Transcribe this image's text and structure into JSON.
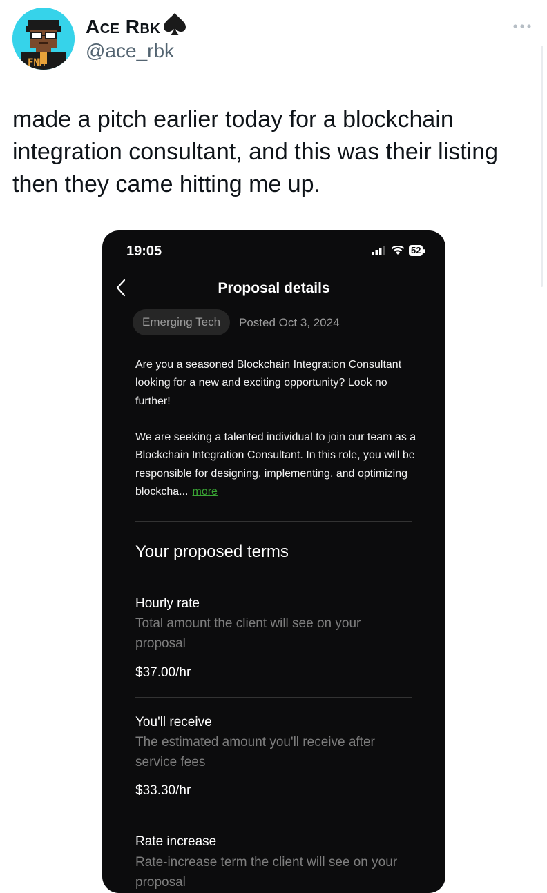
{
  "tweet": {
    "display_name": "Ace Rbk",
    "handle": "@ace_rbk",
    "text": "made a pitch earlier today for a blockchain\nintegration consultant, and this was their listing\nthen they came hitting me up.",
    "avatar_text": "FNM",
    "avatar_bg": "#36d3ea"
  },
  "phone": {
    "status": {
      "time": "19:05",
      "battery": "52"
    },
    "header": {
      "title": "Proposal details"
    },
    "tag": "Emerging Tech",
    "posted": "Posted Oct 3, 2024",
    "description": {
      "paragraph1": "Are you a seasoned Blockchain Integration Consultant looking for a new and exciting opportunity? Look no further!",
      "paragraph2": "We are seeking a talented individual to join our team as a Blockchain Integration Consultant. In this role, you will be responsible for designing, implementing, and optimizing blockcha...",
      "more_label": "more"
    },
    "terms": {
      "title": "Your proposed terms",
      "items": [
        {
          "label": "Hourly rate",
          "help": "Total amount the client will see on your proposal",
          "value": "$37.00/hr"
        },
        {
          "label": "You'll receive",
          "help": "The estimated amount you'll receive after service fees",
          "value": "$33.30/hr"
        },
        {
          "label": "Rate increase",
          "help": "Rate-increase term the client will see on your proposal"
        }
      ]
    },
    "accent_color": "#3aa634",
    "background_color": "#0c0c0d"
  }
}
